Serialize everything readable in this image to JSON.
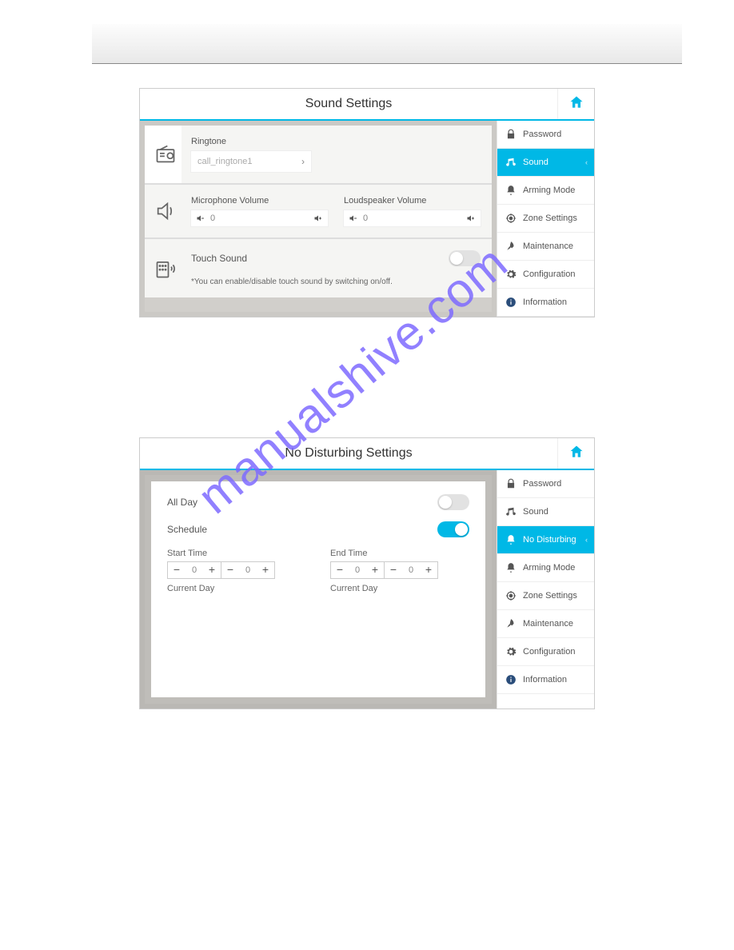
{
  "watermark": "manualshive.com",
  "panel1": {
    "title": "Sound Settings",
    "ringtone": {
      "label": "Ringtone",
      "value": "call_ringtone1"
    },
    "micVol": {
      "label": "Microphone Volume",
      "value": "0"
    },
    "spkVol": {
      "label": "Loudspeaker Volume",
      "value": "0"
    },
    "touch": {
      "label": "Touch Sound",
      "hint": "*You can enable/disable touch sound by switching on/off."
    },
    "sidebar": [
      {
        "label": "Password"
      },
      {
        "label": "Sound"
      },
      {
        "label": "Arming Mode"
      },
      {
        "label": "Zone Settings"
      },
      {
        "label": "Maintenance"
      },
      {
        "label": "Configuration"
      },
      {
        "label": "Information"
      }
    ]
  },
  "panel2": {
    "title": "No Disturbing Settings",
    "allDay": {
      "label": "All Day"
    },
    "schedule": {
      "label": "Schedule"
    },
    "start": {
      "label": "Start Time",
      "h": "0",
      "m": "0",
      "cur": "Current Day"
    },
    "end": {
      "label": "End Time",
      "h": "0",
      "m": "0",
      "cur": "Current Day"
    },
    "sidebar": [
      {
        "label": "Password"
      },
      {
        "label": "Sound"
      },
      {
        "label": "No Disturbing"
      },
      {
        "label": "Arming Mode"
      },
      {
        "label": "Zone Settings"
      },
      {
        "label": "Maintenance"
      },
      {
        "label": "Configuration"
      },
      {
        "label": "Information"
      }
    ]
  }
}
